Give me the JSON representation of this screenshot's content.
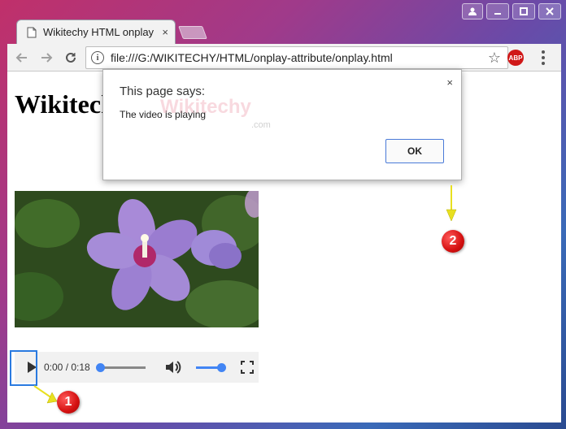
{
  "window": {
    "controls": [
      "user",
      "minimize",
      "maximize",
      "close"
    ]
  },
  "tab": {
    "title": "Wikitechy HTML onplay a",
    "close_glyph": "×"
  },
  "toolbar": {
    "back_icon": "back-arrow-icon",
    "forward_icon": "forward-arrow-icon",
    "reload_icon": "reload-icon",
    "url": "file:///G:/WIKITECHY/HTML/onplay-attribute/onplay.html",
    "abp_label": "ABP"
  },
  "page": {
    "heading": "Wikitechy"
  },
  "video": {
    "time": "0:00 / 0:18"
  },
  "dialog": {
    "title": "This page says:",
    "message": "The video is playing",
    "ok_label": "OK",
    "close_glyph": "×",
    "watermark": "Wikitechy",
    "watermark_sub": ".com"
  },
  "markers": {
    "one": "1",
    "two": "2"
  },
  "colors": {
    "accent": "#4285f4",
    "highlight": "#2a7ae0",
    "marker": "#d41010",
    "arrow": "#e8e020"
  }
}
